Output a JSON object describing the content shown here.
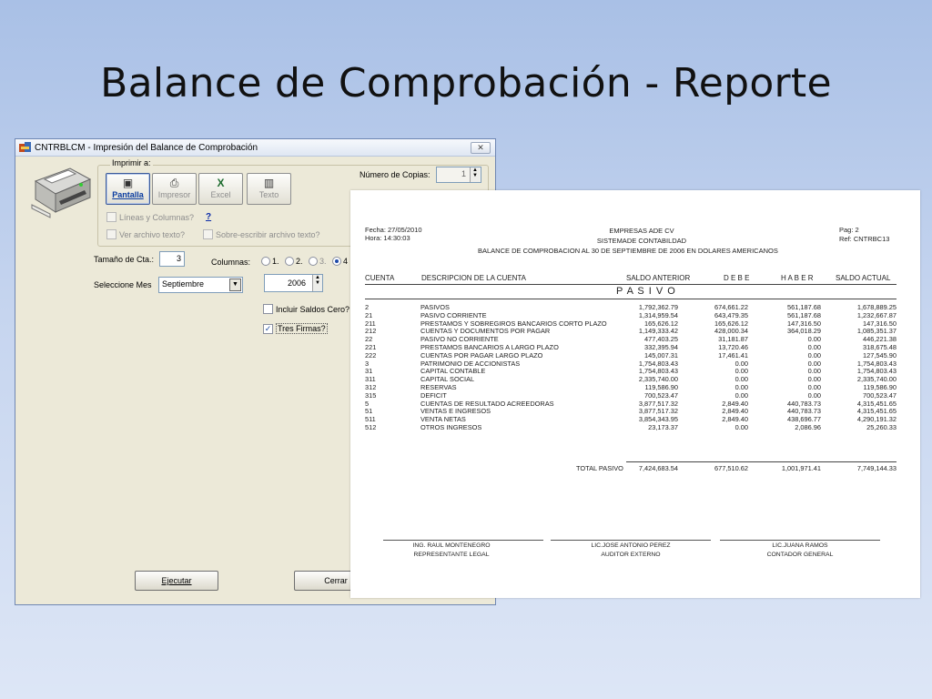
{
  "slide": {
    "title": "Balance de Comprobación - Reporte"
  },
  "window": {
    "title": "CNTRBLCM - Impresión del Balance de Comprobación",
    "close_label": "✕",
    "group_label": "Imprimir a:",
    "buttons": [
      {
        "label": "Pantalla",
        "icon": "screen-icon"
      },
      {
        "label": "Impresor",
        "icon": "printer-icon"
      },
      {
        "label": "Excel",
        "icon": "excel-icon"
      },
      {
        "label": "Texto",
        "icon": "book-icon"
      }
    ],
    "copies_label": "Número de Copias:",
    "copies_value": "1",
    "lineas_label": "Líneas y Columnas?",
    "help_label": "?",
    "ver_texto_label": "Ver archivo texto?",
    "sobre_label": "Sobre-escribir archivo texto?",
    "tamano_label": "Tamaño de Cta.:",
    "tamano_value": "3",
    "columnas_label": "Columnas:",
    "columnas_options": [
      "1.",
      "2.",
      "3.",
      "4"
    ],
    "columnas_selected": "4",
    "mes_label": "Seleccione Mes",
    "mes_value": "Septiembre",
    "year_value": "2006",
    "saldos_cero_label": "Incluir Saldos Cero?",
    "tres_firmas_label": "Tres Firmas?",
    "tres_firmas_checked": true,
    "ejecutar_label": "Ejecutar",
    "cerrar_label": "Cerrar"
  },
  "report": {
    "fecha": "Fecha: 27/05/2010",
    "hora": "Hora:  14:30:03",
    "company": "EMPRESAS ADE CV",
    "system": "SISTEMADE CONTABILDAD",
    "subtitle": "BALANCE DE COMPROBACION  AL 30 DE SEPTIEMBRE DE 2006  EN  DOLARES AMERICANOS",
    "page": "Pag:    2",
    "ref": "Ref: CNTRBC13",
    "headers": {
      "cuenta": "CUENTA",
      "descripcion": "DESCRIPCION DE LA CUENTA",
      "saldo_anterior": "SALDO ANTERIOR",
      "debe": "D E B E",
      "haber": "H A B E R",
      "saldo_actual": "SALDO ACTUAL"
    },
    "section": "P A S I V O",
    "rows": [
      [
        "2",
        "PASIVOS",
        "1,792,362.79",
        "674,661.22",
        "561,187.68",
        "1,678,889.25"
      ],
      [
        "21",
        "PASIVO CORRIENTE",
        "1,314,959.54",
        "643,479.35",
        "561,187.68",
        "1,232,667.87"
      ],
      [
        "211",
        "PRESTAMOS Y SOBREGIROS BANCARIOS CORTO PLAZO",
        "165,626.12",
        "165,626.12",
        "147,316.50",
        "147,316.50"
      ],
      [
        "212",
        "CUENTAS Y DOCUMENTOS POR PAGAR",
        "1,149,333.42",
        "428,000.34",
        "364,018.29",
        "1,085,351.37"
      ],
      [
        "22",
        "PASIVO NO CORRIENTE",
        "477,403.25",
        "31,181.87",
        "0.00",
        "446,221.38"
      ],
      [
        "221",
        "PRESTAMOS BANCARIOS A LARGO PLAZO",
        "332,395.94",
        "13,720.46",
        "0.00",
        "318,675.48"
      ],
      [
        "222",
        "CUENTAS POR PAGAR LARGO PLAZO",
        "145,007.31",
        "17,461.41",
        "0.00",
        "127,545.90"
      ],
      [
        "3",
        "PATRIMONIO DE ACCIONISTAS",
        "1,754,803.43",
        "0.00",
        "0.00",
        "1,754,803.43"
      ],
      [
        "31",
        "CAPITAL CONTABLE",
        "1,754,803.43",
        "0.00",
        "0.00",
        "1,754,803.43"
      ],
      [
        "311",
        "CAPITAL SOCIAL",
        "2,335,740.00",
        "0.00",
        "0.00",
        "2,335,740.00"
      ],
      [
        "312",
        "RESERVAS",
        "119,586.90",
        "0.00",
        "0.00",
        "119,586.90"
      ],
      [
        "315",
        "DEFICIT",
        "700,523.47",
        "0.00",
        "0.00",
        "700,523.47"
      ],
      [
        "5",
        "CUENTAS DE RESULTADO ACREEDORAS",
        "3,877,517.32",
        "2,849.40",
        "440,783.73",
        "4,315,451.65"
      ],
      [
        "51",
        "VENTAS E INGRESOS",
        "3,877,517.32",
        "2,849.40",
        "440,783.73",
        "4,315,451.65"
      ],
      [
        "511",
        "VENTA NETAS",
        "3,854,343.95",
        "2,849.40",
        "438,696.77",
        "4,290,191.32"
      ],
      [
        "512",
        "OTROS INGRESOS",
        "23,173.37",
        "0.00",
        "2,086.96",
        "25,260.33"
      ]
    ],
    "total": {
      "label": "TOTAL PASIVO",
      "saldo_anterior": "7,424,683.54",
      "debe": "677,510.62",
      "haber": "1,001,971.41",
      "saldo_actual": "7,749,144.33"
    },
    "signatures": [
      {
        "name": "ING. RAUL MONTENEGRO",
        "role": "REPRESENTANTE LEGAL"
      },
      {
        "name": "LIC.JOSE ANTONIO PEREZ",
        "role": "AUDITOR EXTERNO"
      },
      {
        "name": "LIC.JUANA RAMOS",
        "role": "CONTADOR GENERAL"
      }
    ]
  }
}
